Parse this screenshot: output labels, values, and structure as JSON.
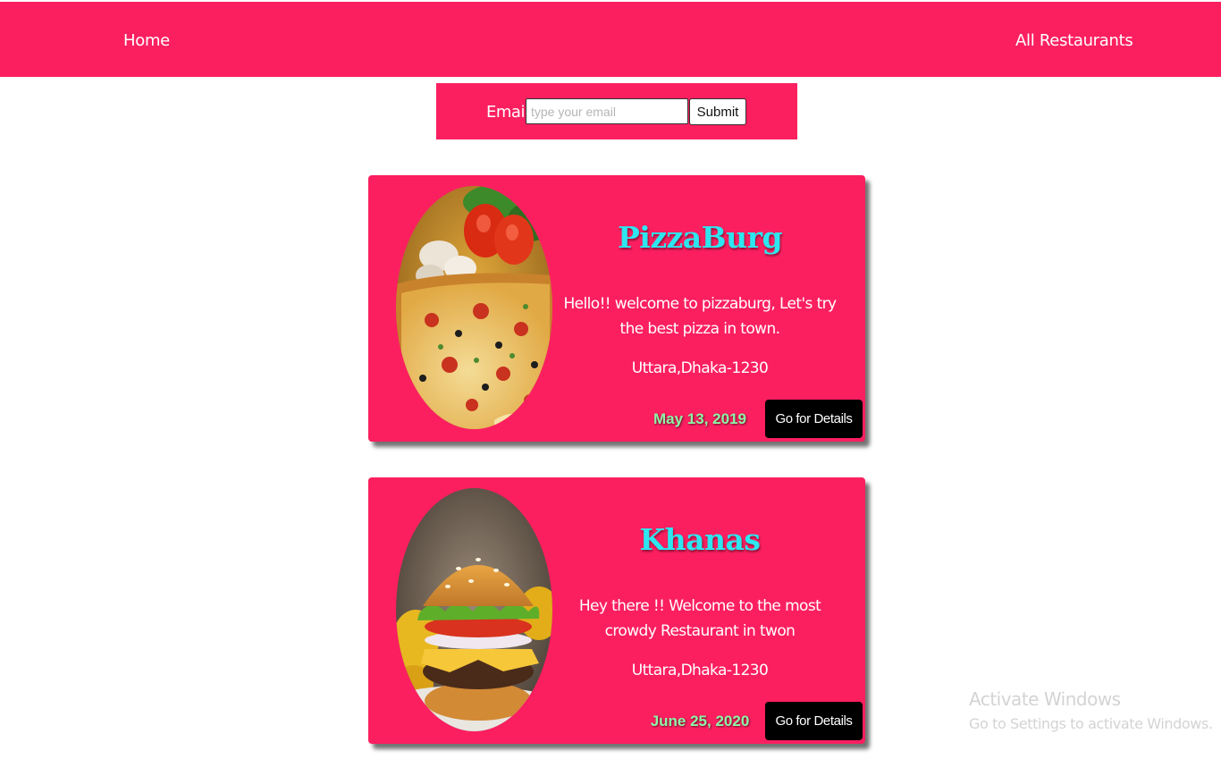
{
  "nav": {
    "home_label": "Home",
    "all_restaurants_label": "All Restaurants"
  },
  "email_form": {
    "label": "Email",
    "placeholder": "type your email",
    "value": "",
    "submit_label": "Submit"
  },
  "restaurants": [
    {
      "name": "PizzaBurg",
      "description": "Hello!! welcome to pizzaburg, Let's try the best pizza in town.",
      "address": "Uttara,Dhaka-1230",
      "date": "May 13, 2019",
      "button_label": "Go for Details",
      "image": "pizza-image"
    },
    {
      "name": "Khanas",
      "description": "Hey there !! Welcome to the most crowdy Restaurant in twon",
      "address": "Uttara,Dhaka-1230",
      "date": "June 25, 2020",
      "button_label": "Go for Details",
      "image": "burger-image"
    }
  ],
  "watermark": {
    "title": "Activate Windows",
    "subtitle": "Go to Settings to activate Windows."
  },
  "colors": {
    "brand": "#fb1f60",
    "title": "#2ee6ef",
    "date": "#8ef5a6",
    "button": "#000000"
  }
}
